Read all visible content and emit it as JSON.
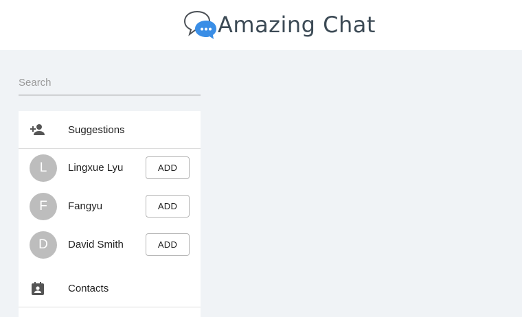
{
  "header": {
    "logo_icon": "chat-bubbles-icon",
    "title": "Amazing Chat"
  },
  "search": {
    "placeholder": "Search",
    "value": ""
  },
  "suggestions": {
    "icon": "person-add-icon",
    "label": "Suggestions",
    "items": [
      {
        "initial": "L",
        "name": "Lingxue Lyu",
        "button": "ADD"
      },
      {
        "initial": "F",
        "name": "Fangyu",
        "button": "ADD"
      },
      {
        "initial": "D",
        "name": "David Smith",
        "button": "ADD"
      }
    ]
  },
  "contacts": {
    "icon": "contact-card-icon",
    "label": "Contacts"
  },
  "colors": {
    "background": "#f0f3f6",
    "avatar": "#bdbdbd",
    "title": "#3c4a55",
    "logo_blue": "#3a8ee6"
  }
}
